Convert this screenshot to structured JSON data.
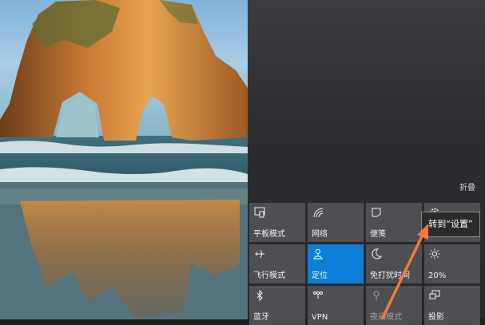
{
  "action_center": {
    "collapse_label": "折叠",
    "tiles": [
      {
        "label": "平板模式",
        "icon": "tablet-mode-icon",
        "active": false
      },
      {
        "label": "网络",
        "icon": "network-icon",
        "active": false
      },
      {
        "label": "便笺",
        "icon": "note-icon",
        "active": false
      },
      {
        "label": "",
        "icon": "gear-icon",
        "active": false
      },
      {
        "label": "飞行模式",
        "icon": "airplane-icon",
        "active": false
      },
      {
        "label": "定位",
        "icon": "location-icon",
        "active": true
      },
      {
        "label": "免打扰时间",
        "icon": "moon-icon",
        "active": false
      },
      {
        "label": "20%",
        "icon": "brightness-icon",
        "active": false
      },
      {
        "label": "蓝牙",
        "icon": "bluetooth-icon",
        "active": false
      },
      {
        "label": "VPN",
        "icon": "vpn-icon",
        "active": false
      },
      {
        "label": "夜间模式",
        "icon": "night-light-icon",
        "active": false
      },
      {
        "label": "投影",
        "icon": "project-icon",
        "active": false
      }
    ]
  },
  "tooltip": {
    "text": "转到“设置”"
  },
  "colors": {
    "accent": "#0b7fd7",
    "annotation_arrow": "#f07a3c"
  }
}
